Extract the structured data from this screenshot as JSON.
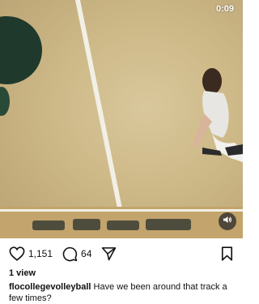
{
  "video": {
    "time_remaining": "0:09"
  },
  "actions": {
    "likes_count": "1,151",
    "comments_count": "64"
  },
  "stats": {
    "views": "1 view"
  },
  "caption": {
    "username": "flocollegevolleyball",
    "text": "Have we been around that track a few times?"
  },
  "icons": {
    "like": "heart-icon",
    "comment": "comment-bubble-icon",
    "share": "paper-plane-icon",
    "save": "bookmark-icon",
    "sound": "speaker-icon"
  }
}
